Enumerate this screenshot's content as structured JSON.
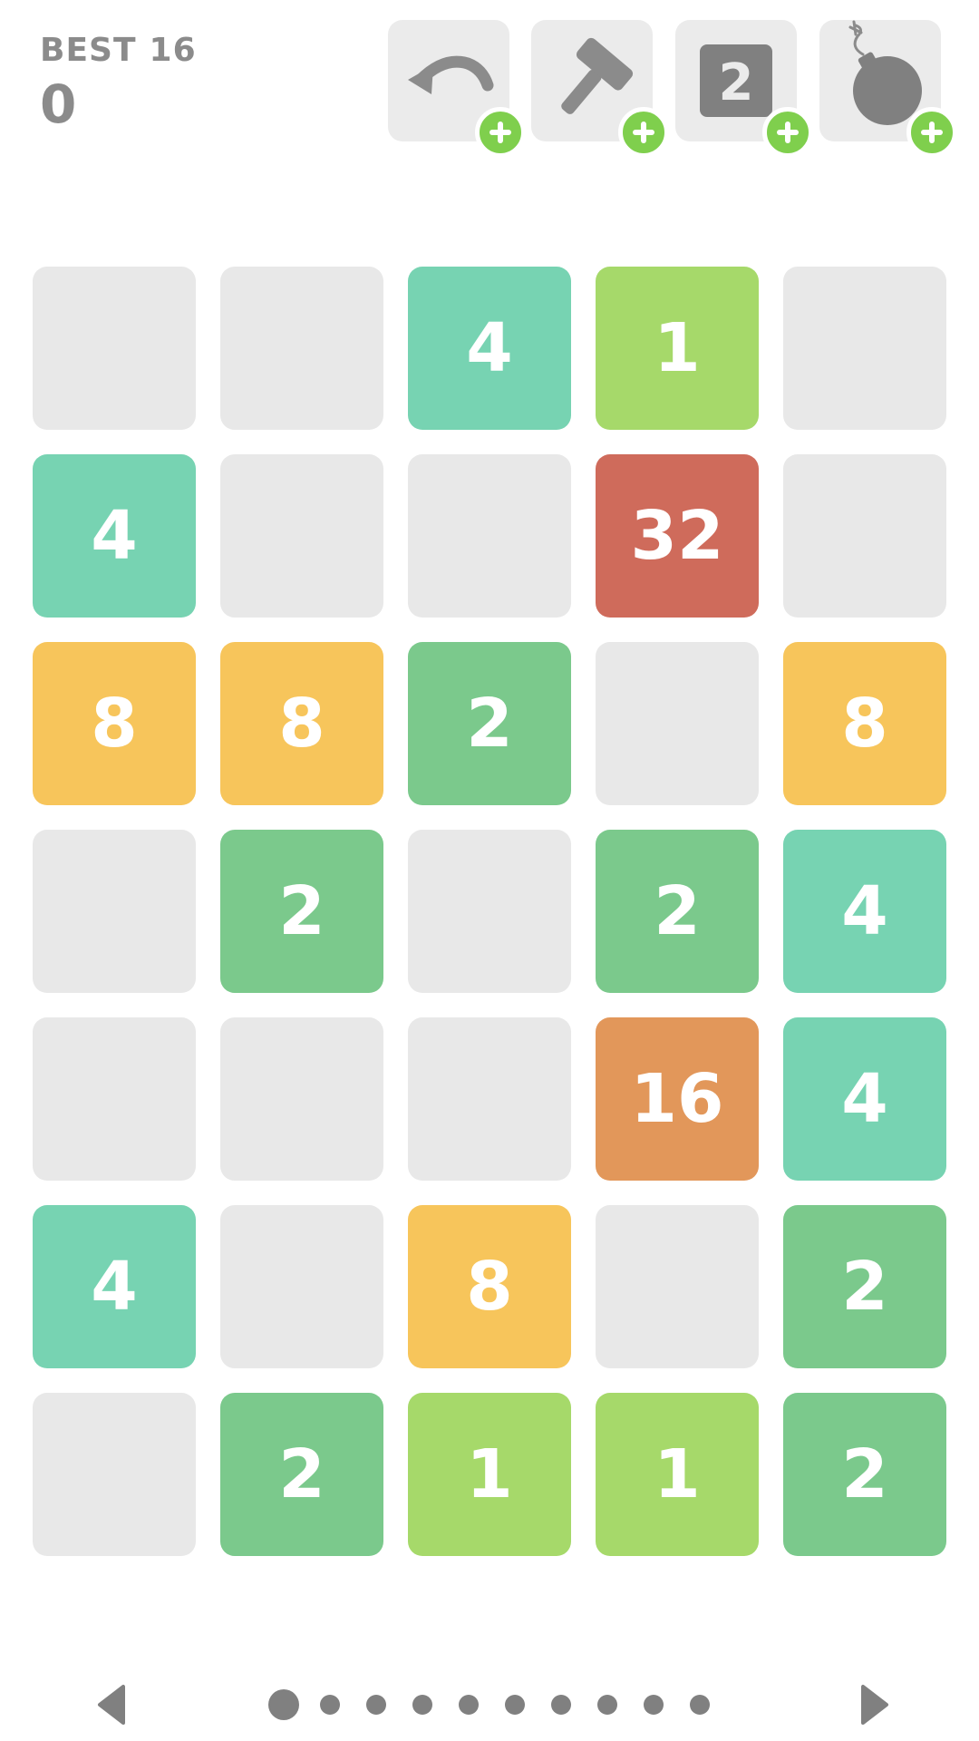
{
  "score": {
    "best_label": "BEST",
    "best_value": "16",
    "current": "0"
  },
  "powerups": [
    {
      "name": "undo-icon",
      "badge": "plus-icon"
    },
    {
      "name": "hammer-icon",
      "badge": "plus-icon"
    },
    {
      "name": "tile-2-icon",
      "badge": "plus-icon",
      "label": "2"
    },
    {
      "name": "bomb-icon",
      "badge": "plus-icon"
    }
  ],
  "board": {
    "columns": 5,
    "rows": 7,
    "tiles": [
      [
        "",
        "",
        "4",
        "1",
        ""
      ],
      [
        "4",
        "",
        "",
        "32",
        ""
      ],
      [
        "8",
        "8",
        "2",
        "",
        "8"
      ],
      [
        "",
        "2",
        "",
        "2",
        "4"
      ],
      [
        "",
        "",
        "",
        "16",
        "4"
      ],
      [
        "4",
        "",
        "8",
        "",
        "2"
      ],
      [
        "",
        "2",
        "1",
        "1",
        "2"
      ]
    ]
  },
  "tile_colors": {
    "empty": "#e8e8e8",
    "1": "#a6d96a",
    "2": "#7bc98c",
    "4": "#77d3b2",
    "8": "#f7c55b",
    "16": "#e2975a",
    "32": "#cf6b5b"
  },
  "colors": {
    "ui_gray": "#8b8b8b",
    "button_bg": "#ebebeb",
    "badge_green": "#7fcf4d"
  },
  "pager": {
    "left_arrow": "left-arrow-icon",
    "right_arrow": "right-arrow-icon",
    "page_count": 10,
    "active_page": 1
  }
}
